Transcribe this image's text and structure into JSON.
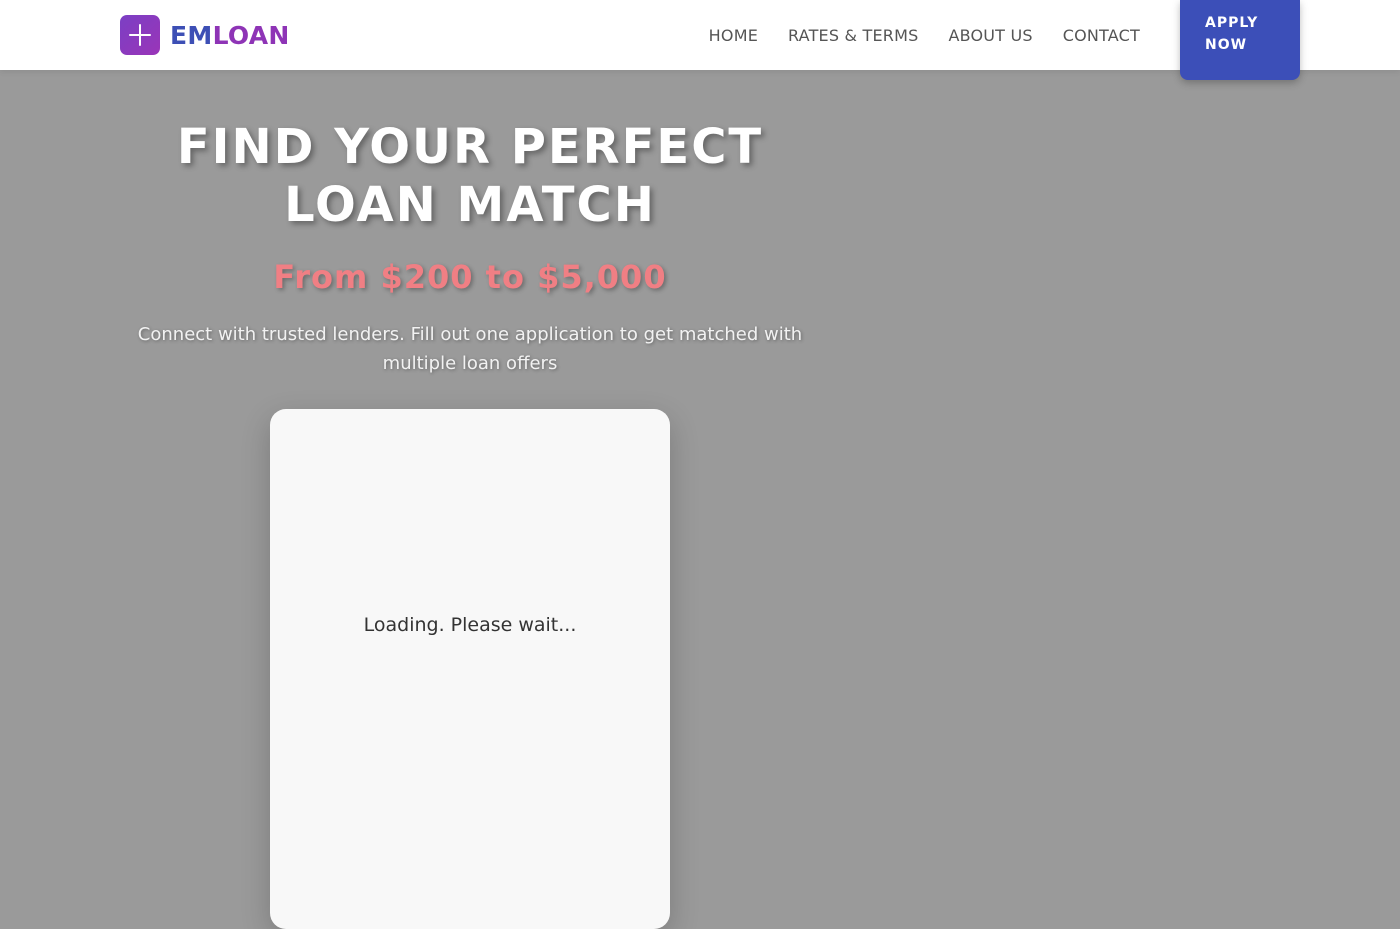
{
  "header": {
    "logo": {
      "icon": "plus-icon",
      "text_part1": "EM",
      "text_part2": "LOAN"
    },
    "nav": [
      {
        "label": "HOME"
      },
      {
        "label": "RATES & TERMS"
      },
      {
        "label": "ABOUT US"
      },
      {
        "label": "CONTACT"
      }
    ],
    "apply_button": {
      "line1": "APPLY",
      "line2": "NOW"
    }
  },
  "hero": {
    "title": "FIND YOUR PERFECT LOAN MATCH",
    "range": "From $200 to $5,000",
    "subtitle": "Connect with trusted lenders. Fill out one application to get matched with multiple loan offers"
  },
  "form_card": {
    "loading_text": "Loading. Please wait..."
  },
  "colors": {
    "brand_blue": "#3c4fb8",
    "brand_purple": "#8e34b6",
    "accent_pink": "#f07f84",
    "overlay_gray": "#9a9a9a"
  }
}
